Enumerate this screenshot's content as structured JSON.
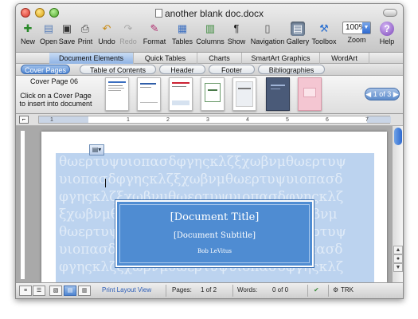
{
  "window": {
    "title": "another blank doc.docx"
  },
  "toolbar": {
    "items": [
      {
        "label": "New",
        "icon": "new-document-icon"
      },
      {
        "label": "Open",
        "icon": "open-folder-icon"
      },
      {
        "label": "Save",
        "icon": "save-disk-icon"
      },
      {
        "label": "Print",
        "icon": "printer-icon"
      },
      {
        "label": "Undo",
        "icon": "undo-arrow-icon"
      },
      {
        "label": "Redo",
        "icon": "redo-arrow-icon"
      },
      {
        "label": "Format",
        "icon": "format-brush-icon"
      },
      {
        "label": "Tables",
        "icon": "table-grid-icon"
      },
      {
        "label": "Columns",
        "icon": "columns-icon"
      },
      {
        "label": "Show",
        "icon": "pilcrow-icon"
      },
      {
        "label": "Navigation",
        "icon": "navigation-pane-icon"
      },
      {
        "label": "Gallery",
        "icon": "gallery-icon"
      },
      {
        "label": "Toolbox",
        "icon": "toolbox-icon"
      },
      {
        "label": "Zoom",
        "value": "100%"
      },
      {
        "label": "Help",
        "icon": "help-icon"
      }
    ]
  },
  "ribbon": {
    "tabs": [
      "Document Elements",
      "Quick Tables",
      "Charts",
      "SmartArt Graphics",
      "WordArt"
    ],
    "active_tab": "Document Elements",
    "subtabs": [
      "Cover Pages",
      "Table of Contents",
      "Header",
      "Footer",
      "Bibliographies"
    ],
    "active_subtab": "Cover Pages"
  },
  "gallery": {
    "title": "Cover Page 06",
    "help": "Click on a Cover Page to insert into document",
    "pager": "1 of 3"
  },
  "ruler": {
    "ticks": [
      "1",
      "1",
      "2",
      "3",
      "4",
      "5",
      "6",
      "7"
    ]
  },
  "document": {
    "greek_lines": [
      "θωερτυψυιοπασδφγηςκλζξχωβνμθωερτυψ",
      "υιοπασδφγηςκλζξχωβνμθωερτυψυιοπασδ",
      "φγηςκλζξχωβνμθωερτυψυιοπασδφγηςκλζ",
      "ξχωβνμθωερτυψυιοπασδφγηςκλζξχωβνμ",
      "θωερτυψυιοπασδφγηςκλζξχωβνμθωερτυψ",
      "υιοπασδφγηςκλζξχωβνμθωερτυψυιοπασδ",
      "φγηςκλζξχωβνμθωερτυψυιοπασδφγηςκλζ"
    ],
    "title": "[Document Title]",
    "subtitle": "[Document Subtitle]",
    "author": "Bob LeVitus"
  },
  "status": {
    "view": "Print Layout View",
    "pages_label": "Pages:",
    "pages_value": "1 of 2",
    "words_label": "Words:",
    "words_value": "0 of 0",
    "trk": "TRK"
  }
}
